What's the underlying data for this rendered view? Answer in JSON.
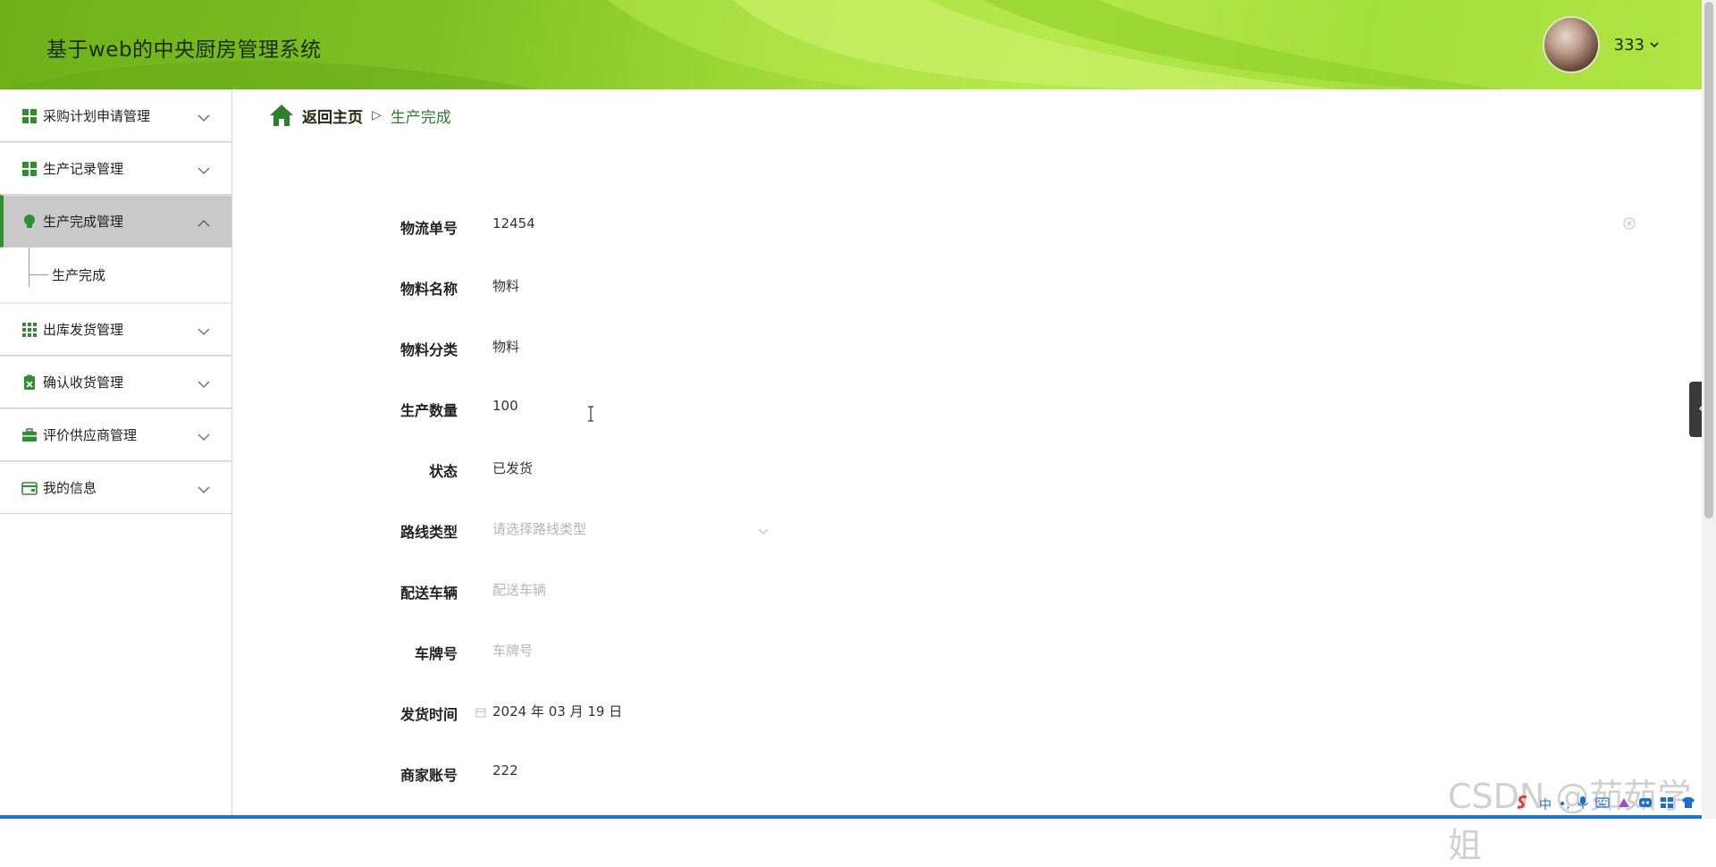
{
  "header": {
    "app_title": "基于web的中央厨房管理系统",
    "user_name": "333"
  },
  "sidebar": {
    "items": [
      {
        "label": "采购计划申请管理",
        "icon": "grid-icon"
      },
      {
        "label": "生产记录管理",
        "icon": "grid-icon"
      },
      {
        "label": "生产完成管理",
        "icon": "lightbulb-icon",
        "active": true,
        "sub": [
          {
            "label": "生产完成"
          }
        ]
      },
      {
        "label": "出库发货管理",
        "icon": "apps-grid-icon"
      },
      {
        "label": "确认收货管理",
        "icon": "clipboard-check-icon"
      },
      {
        "label": "评价供应商管理",
        "icon": "briefcase-icon"
      },
      {
        "label": "我的信息",
        "icon": "card-icon"
      }
    ]
  },
  "breadcrumb": {
    "home": "返回主页",
    "separator": "▷",
    "current": "生产完成"
  },
  "form": {
    "fields": [
      {
        "label": "物流单号",
        "value": "12454"
      },
      {
        "label": "物料名称",
        "value": "物料"
      },
      {
        "label": "物料分类",
        "value": "物料"
      },
      {
        "label": "生产数量",
        "value": "100"
      },
      {
        "label": "状态",
        "value": "已发货"
      },
      {
        "label": "路线类型",
        "placeholder": "请选择路线类型"
      },
      {
        "label": "配送车辆",
        "placeholder": "配送车辆"
      },
      {
        "label": "车牌号",
        "placeholder": "车牌号"
      },
      {
        "label": "发货时间",
        "value": "2024 年 03 月 19 日"
      },
      {
        "label": "商家账号",
        "value": "222"
      }
    ]
  },
  "watermark": "CSDN @茹茹学姐",
  "tray": {
    "lang": "中"
  },
  "colors": {
    "accent_green": "#2f8f2f",
    "header_green": "#8fd12c",
    "active_menu_bg": "#c9c9c9"
  }
}
